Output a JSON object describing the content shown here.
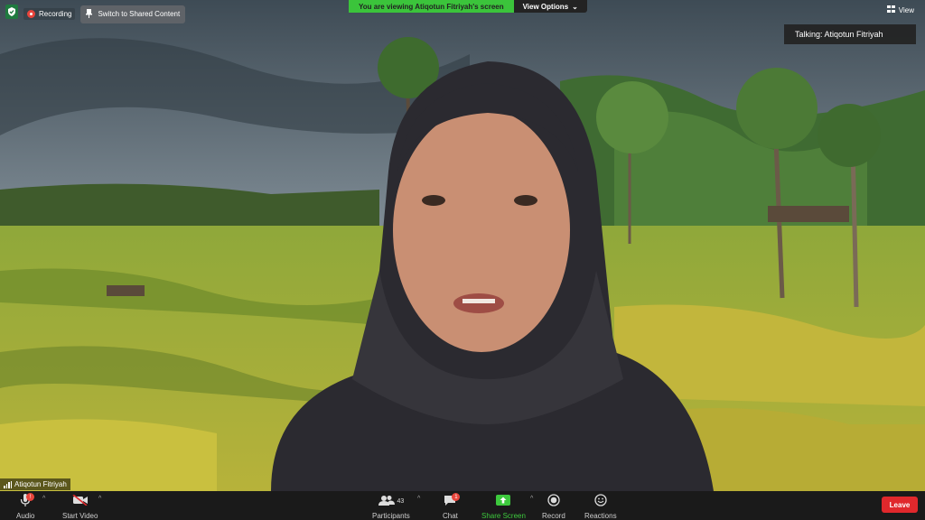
{
  "top": {
    "recording_label": "Recording",
    "switch_label": "Switch to Shared Content",
    "viewing_message": "You are viewing Atiqotun Fitriyah's screen",
    "view_options_label": "View Options",
    "view_label": "View"
  },
  "talking": {
    "label": "Talking: Atiqotun Fitriyah"
  },
  "participant": {
    "name": "Atiqotun Fitriyah"
  },
  "toolbar": {
    "audio_label": "Audio",
    "start_video_label": "Start Video",
    "participants_label": "Participants",
    "participants_count": "43",
    "chat_label": "Chat",
    "chat_badge": "1",
    "share_screen_label": "Share Screen",
    "record_label": "Record",
    "reactions_label": "Reactions",
    "leave_label": "Leave"
  },
  "colors": {
    "accent_green": "#3bc43b",
    "leave_red": "#e0282c",
    "toolbar_bg": "#1a1a1a"
  }
}
